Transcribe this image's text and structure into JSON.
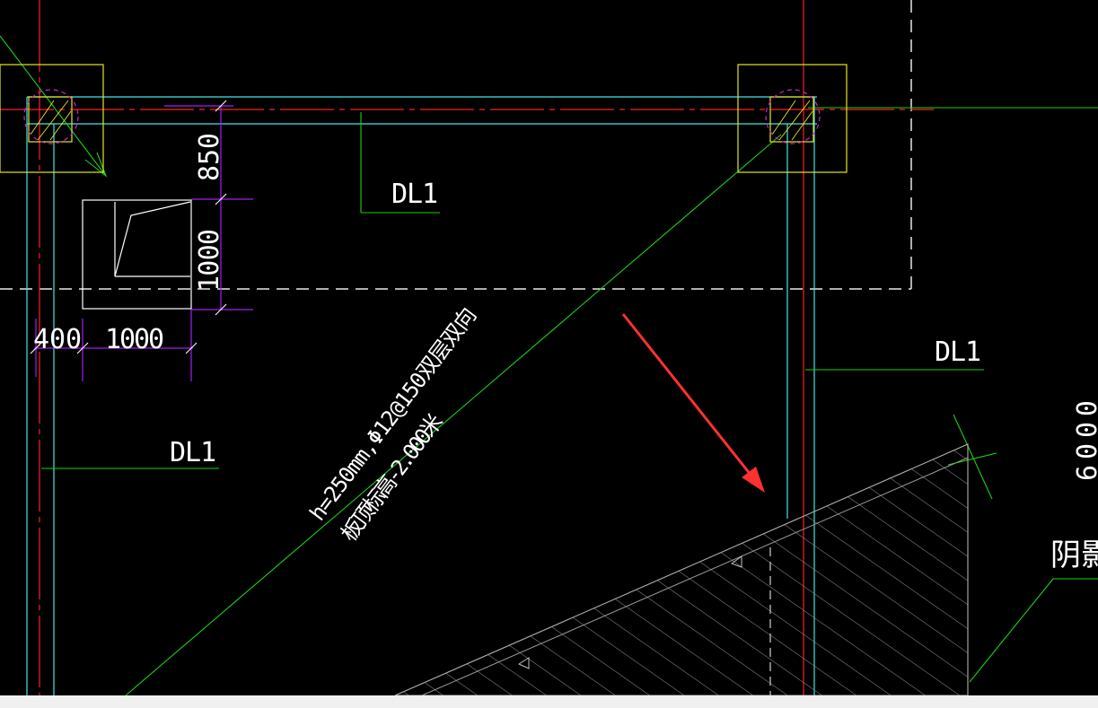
{
  "drawing": {
    "labels": {
      "beam_top": "DL1",
      "beam_right": "DL1",
      "beam_left": "DL1",
      "dim_850": "850",
      "dim_1000_v": "1000",
      "dim_400": "400",
      "dim_1000_h": "1000",
      "dim_6000": "6000",
      "slab_note_line1": "h=250mm,Φ12@150双层双向",
      "slab_note_line2": "板顶标高-2.000米",
      "shade_label": "阴影"
    },
    "colors": {
      "background": "#000000",
      "axis_red": "#ff2020",
      "beam_cyan": "#3fe6e6",
      "leader_green": "#19d219",
      "column_yellow": "#e6e61e",
      "dim_purple": "#a020f0",
      "column_magenta": "#d020d0",
      "text_white": "#ffffff",
      "hatch_gray": "#9a9a9a",
      "arrow_red": "#ff3030"
    }
  }
}
